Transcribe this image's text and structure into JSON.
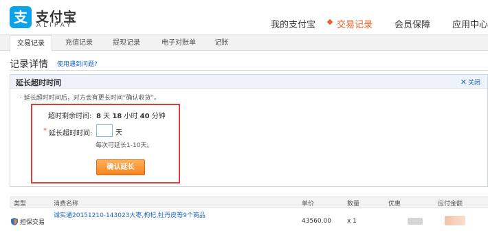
{
  "brand": {
    "name_cn": "支付宝",
    "name_en": "ALIPAY",
    "mark": "支"
  },
  "topnav": [
    {
      "label": "我的支付宝",
      "active": false
    },
    {
      "label": "交易记录",
      "active": true
    },
    {
      "label": "会员保障",
      "active": false
    },
    {
      "label": "应用中心",
      "active": false
    }
  ],
  "subnav": [
    {
      "label": "交易记录",
      "active": true
    },
    {
      "label": "充值记录",
      "active": false
    },
    {
      "label": "提现记录",
      "active": false
    },
    {
      "label": "电子对账单",
      "active": false
    },
    {
      "label": "记账",
      "active": false
    }
  ],
  "section": {
    "title": "记录详情",
    "help_link": "使用遇到问题?"
  },
  "panel": {
    "title": "延长超时时间",
    "close": "关闭",
    "close_icon": "close-x-icon",
    "note": "· 延长超时时间后，对方会有更长时间“确认收货”。",
    "remaining_label": "超时剩余时间:",
    "remaining": {
      "days": "8",
      "day_unit": "天",
      "hours": "18",
      "hour_unit": "小时",
      "minutes": "40",
      "minute_unit": "分钟"
    },
    "extend_label": "延长超时时间:",
    "required_mark": "*",
    "days_input_value": "",
    "days_unit": "天",
    "hint": "每次可延长1-10天。",
    "confirm_button": "确认延长"
  },
  "table": {
    "headers": [
      "类型",
      "消费名称",
      "单价",
      "数量",
      "优惠",
      "应付金额"
    ],
    "rows": [
      {
        "type_icon": "shield-icon",
        "type": "担保交易",
        "name": "诚实通20151210-143023大枣,枸杞,牡丹皮等9个商品",
        "price": "43560.00",
        "qty": "x 1"
      }
    ]
  },
  "colors": {
    "accent": "#f15a22",
    "link": "#1a64c4",
    "highlight_border": "#e03a3a",
    "button": "#f7841d",
    "brand_blue": "#0ea2e6"
  }
}
